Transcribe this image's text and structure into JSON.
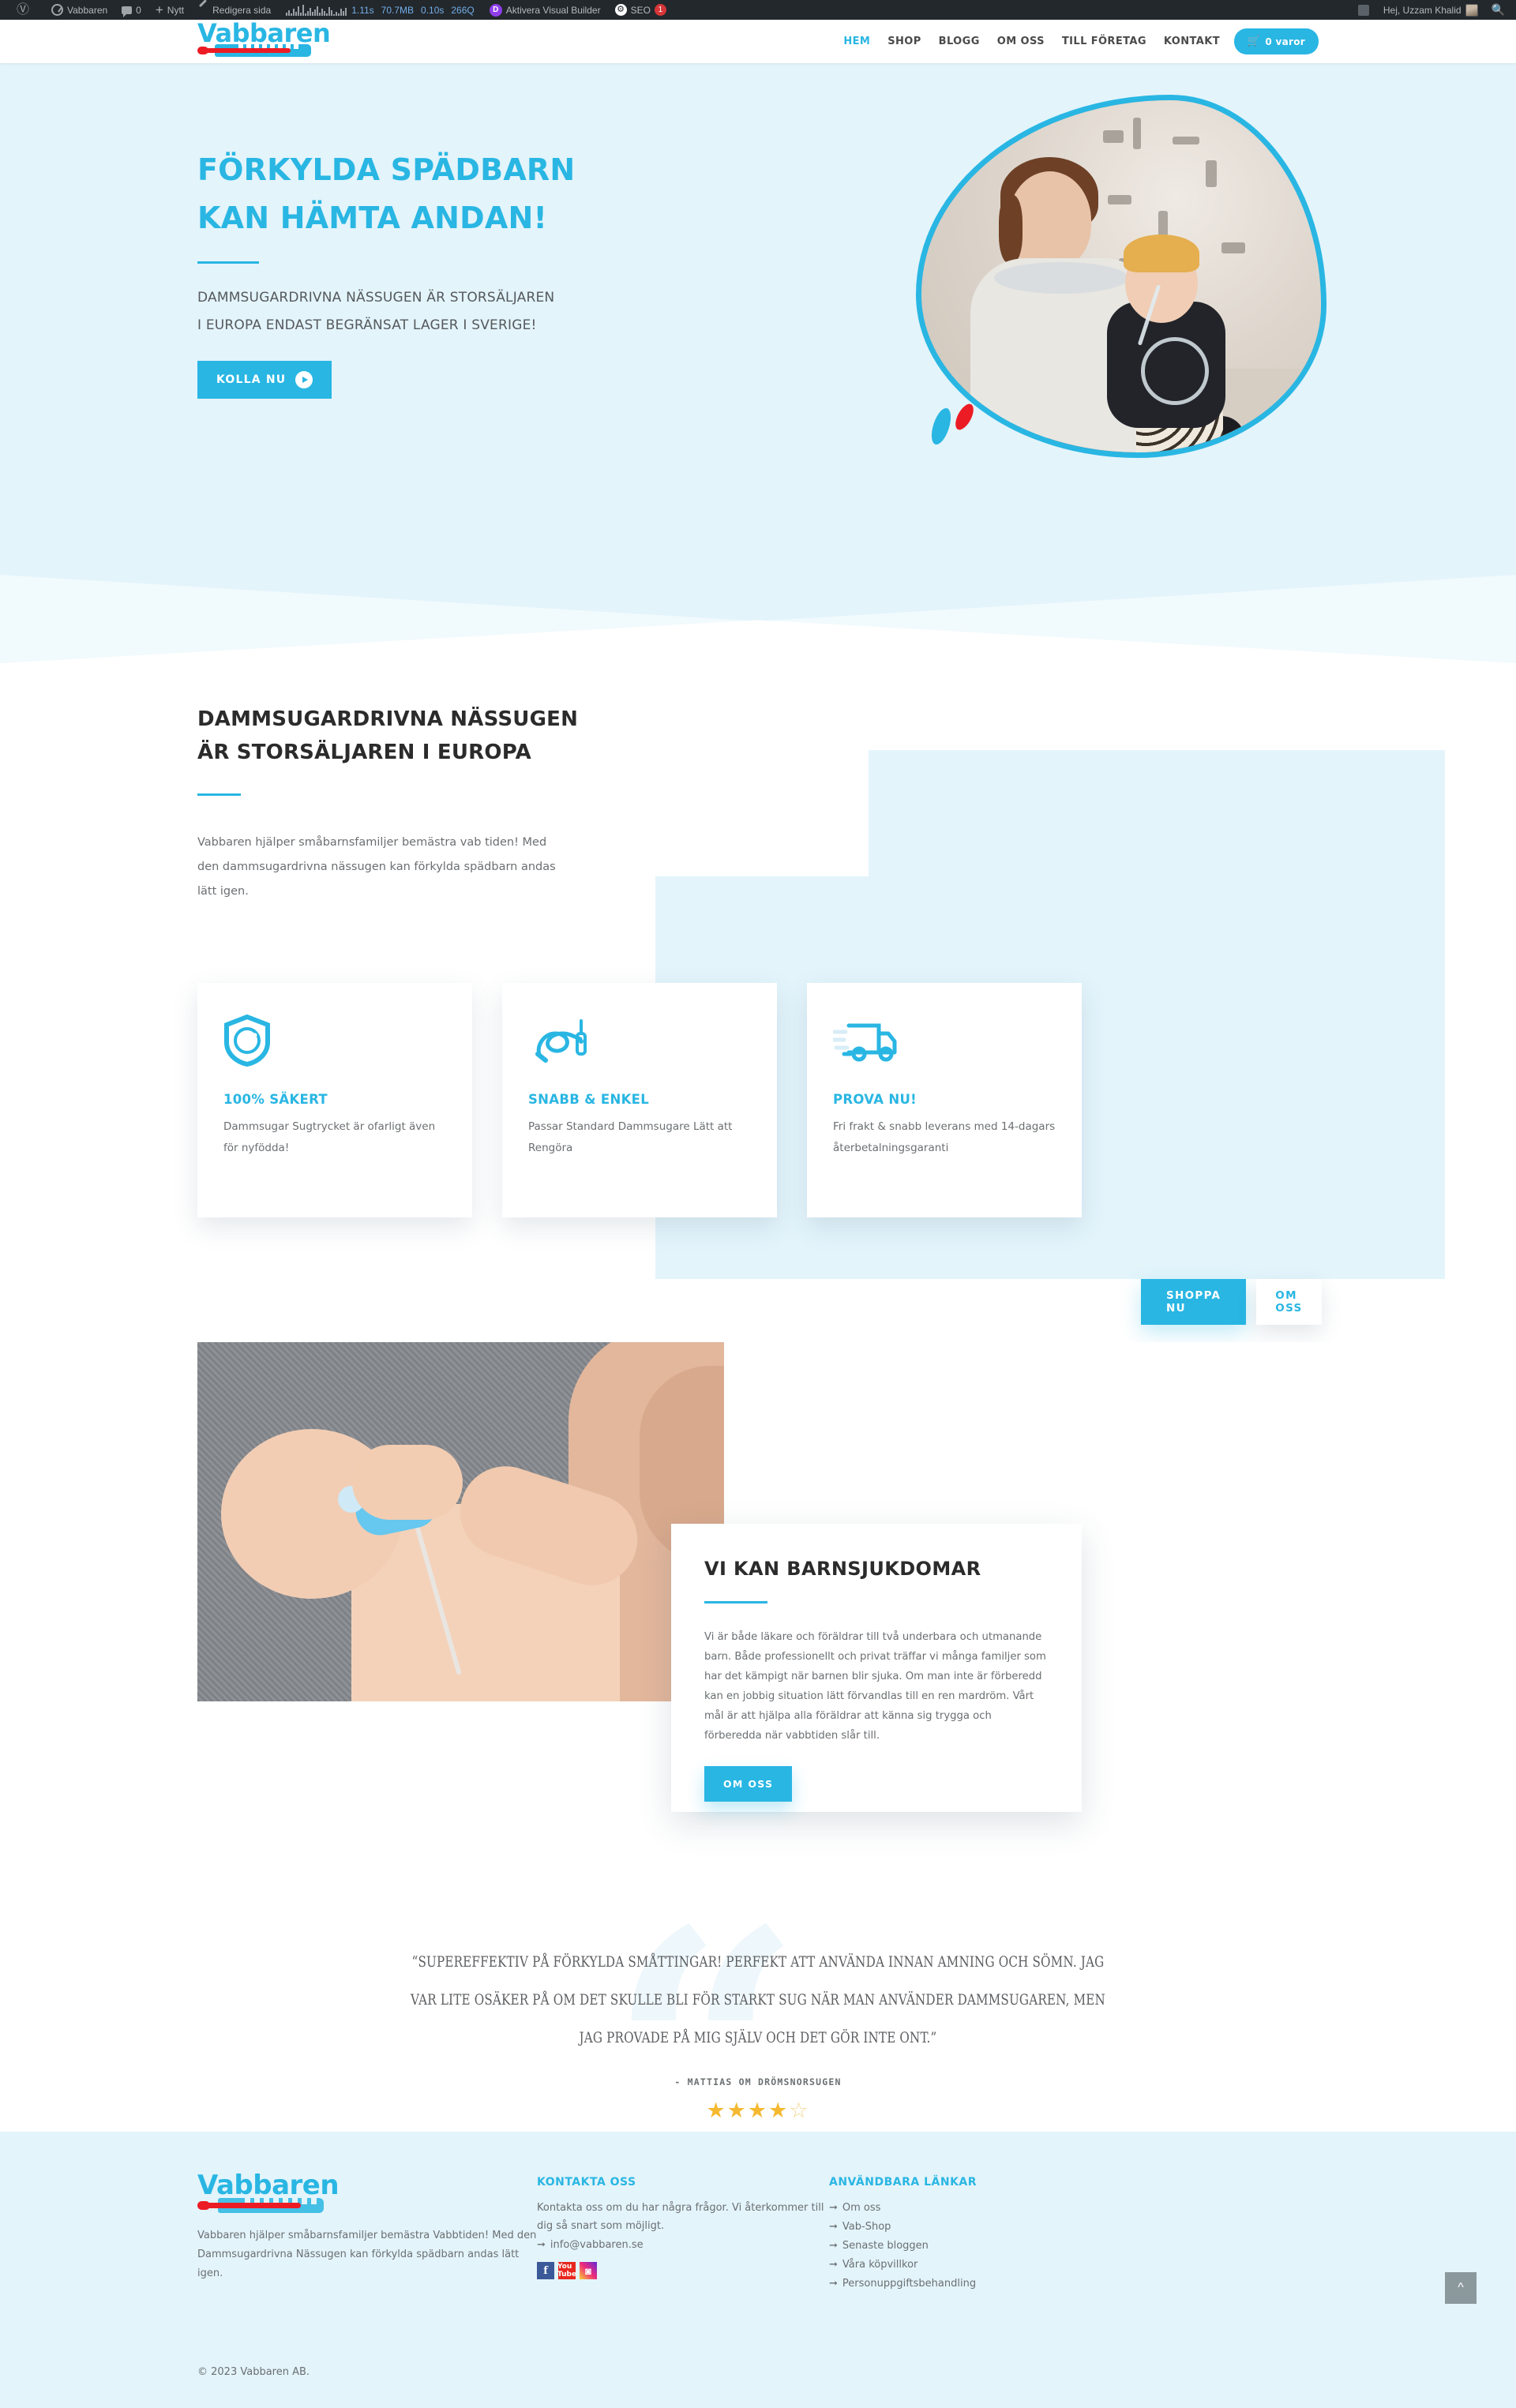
{
  "adminbar": {
    "wp_logo_icon": "wordpress-icon",
    "site_name": "Vabbaren",
    "site_icon": "dashboard-icon",
    "comments_icon": "comment-bubble-icon",
    "comments_count": "0",
    "new_icon": "plus-icon",
    "new_label": "Nytt",
    "edit_icon": "pencil-icon",
    "edit_label": "Redigera sida",
    "qm_time": "1.11s",
    "qm_memory": "70.7MB",
    "qm_db": "0.10s",
    "qm_queries": "266Q",
    "divi_icon": "divi-icon",
    "divi_label": "Aktivera Visual Builder",
    "seo_icon": "yoast-seo-icon",
    "seo_label": "SEO",
    "seo_badge": "1",
    "howdy": "Hej, Uzzam Khalid",
    "avatar": "user-avatar",
    "search_icon": "search-icon",
    "flag_icon": "flag-icon"
  },
  "header": {
    "logo_word": "Vabbaren",
    "logo_icon": "thermometer-icon",
    "nav": [
      {
        "label": "HEM",
        "active": true
      },
      {
        "label": "SHOP",
        "active": false
      },
      {
        "label": "BLOGG",
        "active": false
      },
      {
        "label": "OM OSS",
        "active": false
      },
      {
        "label": "TILL FÖRETAG",
        "active": false
      },
      {
        "label": "KONTAKT",
        "active": false
      }
    ],
    "cart_icon": "shopping-cart-icon",
    "cart_label": "0 varor"
  },
  "hero": {
    "title_line1": "FÖRKYLDA SPÄDBARN",
    "title_line2": "KAN HÄMTA ANDAN!",
    "sub_line1": "DAMMSUGARDRIVNA NÄSSUGEN ÄR STORSÄLJAREN",
    "sub_line2": "I EUROPA ENDAST BEGRÄNSAT LAGER I SVERIGE!",
    "cta_label": "KOLLA NU",
    "cta_icon": "play-circle-icon",
    "image_alt": "mother-holding-baby-photo"
  },
  "section2": {
    "heading_line1": "DAMMSUGARDRIVNA NÄSSUGEN",
    "heading_line2": "ÄR STORSÄLJAREN I EUROPA",
    "paragraph": "Vabbaren hjälper småbarnsfamiljer bemästra vab tiden! Med den dammsugardrivna nässugen kan förkylda spädbarn andas lätt igen.",
    "cards": [
      {
        "icon": "shield-check-icon",
        "title": "100% SÄKERT",
        "text": "Dammsugar Sugtrycket är ofarligt även för nyfödda!"
      },
      {
        "icon": "vacuum-cleaner-icon",
        "title": "SNABB & ENKEL",
        "text": "Passar Standard Dammsugare Lätt att Rengöra"
      },
      {
        "icon": "delivery-truck-icon",
        "title": "PROVA NU!",
        "text": "Fri frakt & snabb leverans med 14-dagars återbetalningsgaranti"
      }
    ],
    "btn_primary": "SHOPPA NU",
    "btn_secondary": "OM OSS"
  },
  "section3": {
    "image_alt": "baby-nasal-aspirator-photo",
    "title": "VI KAN BARNSJUKDOMAR",
    "paragraph": "Vi är både läkare och föräldrar till två underbara och utmanande barn. Både professionellt och privat träffar vi många familjer som har det kämpigt när barnen blir sjuka. Om man inte är förberedd kan en jobbig situation lätt förvandlas till en ren mardröm. Vårt mål är att hjälpa alla föräldrar att känna sig trygga och förberedda när vabbtiden slår till.",
    "btn_label": "OM OSS"
  },
  "testimonial": {
    "quote_line1": "“SUPEREFFEKTIV PÅ FÖRKYLDA SMÅTTINGAR! PERFEKT ATT ANVÄNDA INNAN AMNING OCH SÖMN. JAG",
    "quote_line2": "VAR LITE OSÄKER PÅ OM DET SKULLE BLI FÖR STARKT SUG NÄR MAN ANVÄNDER DAMMSUGAREN, MEN",
    "quote_line3": "JAG PROVADE PÅ MIG SJÄLV OCH DET GÖR INTE ONT.”",
    "author": "- MATTIAS OM DRÖMSNORSUGEN",
    "rating": 4,
    "rating_max": 5
  },
  "footer": {
    "logo_word": "Vabbaren",
    "logo_icon": "thermometer-icon",
    "about": "Vabbaren hjälper småbarnsfamiljer bemästra Vabbtiden! Med den Dammsugardrivna Nässugen kan förkylda spädbarn andas lätt igen.",
    "contact_heading": "KONTAKTA OSS",
    "contact_text": "Kontakta oss om du har några frågor. Vi återkommer till dig så snart som möjligt.",
    "contact_email": "info@vabbaren.se",
    "social": [
      {
        "name": "facebook-icon",
        "glyph": "f"
      },
      {
        "name": "youtube-icon",
        "glyph": "You Tube"
      },
      {
        "name": "instagram-icon",
        "glyph": "◙"
      }
    ],
    "links_heading": "ANVÄNDBARA LÄNKAR",
    "links": [
      "Om oss",
      "Vab-Shop",
      "Senaste bloggen",
      "Våra köpvillkor",
      "Personuppgiftsbehandling"
    ],
    "copyright": "© 2023 Vabbaren AB.",
    "totop_icon": "chevron-up-icon"
  },
  "colors": {
    "brand": "#29b6e3",
    "brand_light": "#e3f4fb",
    "red": "#ec1c24",
    "text": "#6b6f72",
    "star": "#f5b931"
  }
}
